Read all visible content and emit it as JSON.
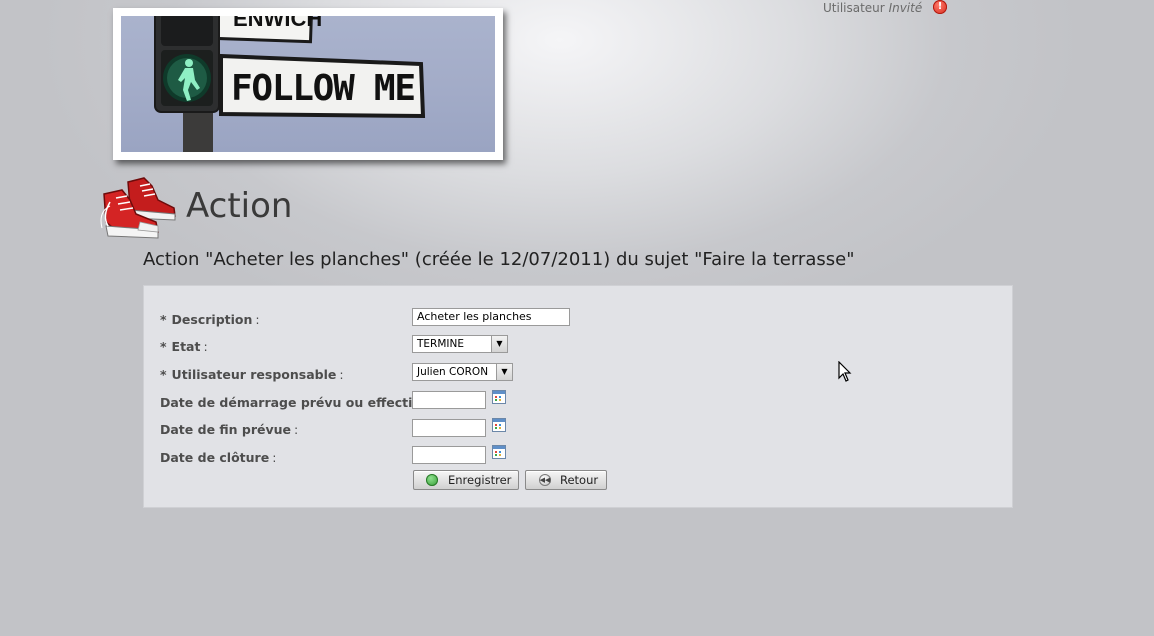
{
  "header": {
    "user_label": "Utilisateur",
    "user_name": "Invité",
    "warning_icon": "warning-icon",
    "banner_sign_text": "FOLLOW ME",
    "banner_top_sign_text": "ENWICH"
  },
  "page": {
    "title": "Action",
    "title_icon": "sneakers-icon",
    "subtitle": "Action \"Acheter les planches\" (créée le 12/07/2011) du sujet \"Faire la terrasse\""
  },
  "form": {
    "fields": {
      "description": {
        "required": "*",
        "label": "Description",
        "colon": ":",
        "value": "Acheter les planches"
      },
      "etat": {
        "required": "*",
        "label": "Etat",
        "colon": ":",
        "value": "TERMINE"
      },
      "responsable": {
        "required": "*",
        "label": "Utilisateur responsable",
        "colon": ":",
        "value": "Julien CORON"
      },
      "date_demarrage": {
        "label": "Date de démarrage prévu ou effectif",
        "colon": ":",
        "value": ""
      },
      "date_fin": {
        "label": "Date de fin prévue",
        "colon": ":",
        "value": ""
      },
      "date_cloture": {
        "label": "Date de clôture",
        "colon": ":",
        "value": ""
      }
    },
    "buttons": {
      "save": "Enregistrer",
      "back": "Retour"
    }
  },
  "colors": {
    "panel_bg": "#e1e2e6",
    "save_icon": "#3fae3f",
    "warning": "#d6281a"
  }
}
